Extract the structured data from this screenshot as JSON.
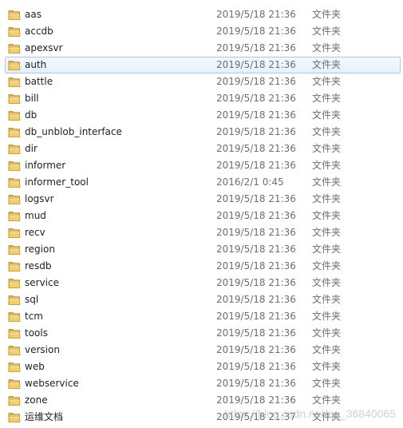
{
  "folder_type_label": "文件夹",
  "folder_icon": "folder-icon",
  "colors": {
    "selection_border": "#a8c8ec",
    "selection_fill": "#e6f0fb",
    "folder_yellow": "#e8c35a",
    "secondary_text": "#6d6d6d"
  },
  "files": [
    {
      "name": "aas",
      "date": "2019/5/18 21:36",
      "type": "文件夹"
    },
    {
      "name": "accdb",
      "date": "2019/5/18 21:36",
      "type": "文件夹"
    },
    {
      "name": "apexsvr",
      "date": "2019/5/18 21:36",
      "type": "文件夹"
    },
    {
      "name": "auth",
      "date": "2019/5/18 21:36",
      "type": "文件夹",
      "selected": true
    },
    {
      "name": "battle",
      "date": "2019/5/18 21:36",
      "type": "文件夹"
    },
    {
      "name": "bill",
      "date": "2019/5/18 21:36",
      "type": "文件夹"
    },
    {
      "name": "db",
      "date": "2019/5/18 21:36",
      "type": "文件夹"
    },
    {
      "name": "db_unblob_interface",
      "date": "2019/5/18 21:36",
      "type": "文件夹"
    },
    {
      "name": "dir",
      "date": "2019/5/18 21:36",
      "type": "文件夹"
    },
    {
      "name": "informer",
      "date": "2019/5/18 21:36",
      "type": "文件夹"
    },
    {
      "name": "informer_tool",
      "date": "2016/2/1 0:45",
      "type": "文件夹"
    },
    {
      "name": "logsvr",
      "date": "2019/5/18 21:36",
      "type": "文件夹"
    },
    {
      "name": "mud",
      "date": "2019/5/18 21:36",
      "type": "文件夹"
    },
    {
      "name": "recv",
      "date": "2019/5/18 21:36",
      "type": "文件夹"
    },
    {
      "name": "region",
      "date": "2019/5/18 21:36",
      "type": "文件夹"
    },
    {
      "name": "resdb",
      "date": "2019/5/18 21:36",
      "type": "文件夹"
    },
    {
      "name": "service",
      "date": "2019/5/18 21:36",
      "type": "文件夹"
    },
    {
      "name": "sql",
      "date": "2019/5/18 21:36",
      "type": "文件夹"
    },
    {
      "name": "tcm",
      "date": "2019/5/18 21:36",
      "type": "文件夹"
    },
    {
      "name": "tools",
      "date": "2019/5/18 21:36",
      "type": "文件夹"
    },
    {
      "name": "version",
      "date": "2019/5/18 21:36",
      "type": "文件夹"
    },
    {
      "name": "web",
      "date": "2019/5/18 21:36",
      "type": "文件夹"
    },
    {
      "name": "webservice",
      "date": "2019/5/18 21:36",
      "type": "文件夹"
    },
    {
      "name": "zone",
      "date": "2019/5/18 21:36",
      "type": "文件夹"
    },
    {
      "name": "运维文档",
      "date": "2019/5/18 21:37",
      "type": "文件夹"
    }
  ],
  "watermark": "https://blog.csdn.net/qq_36840065"
}
